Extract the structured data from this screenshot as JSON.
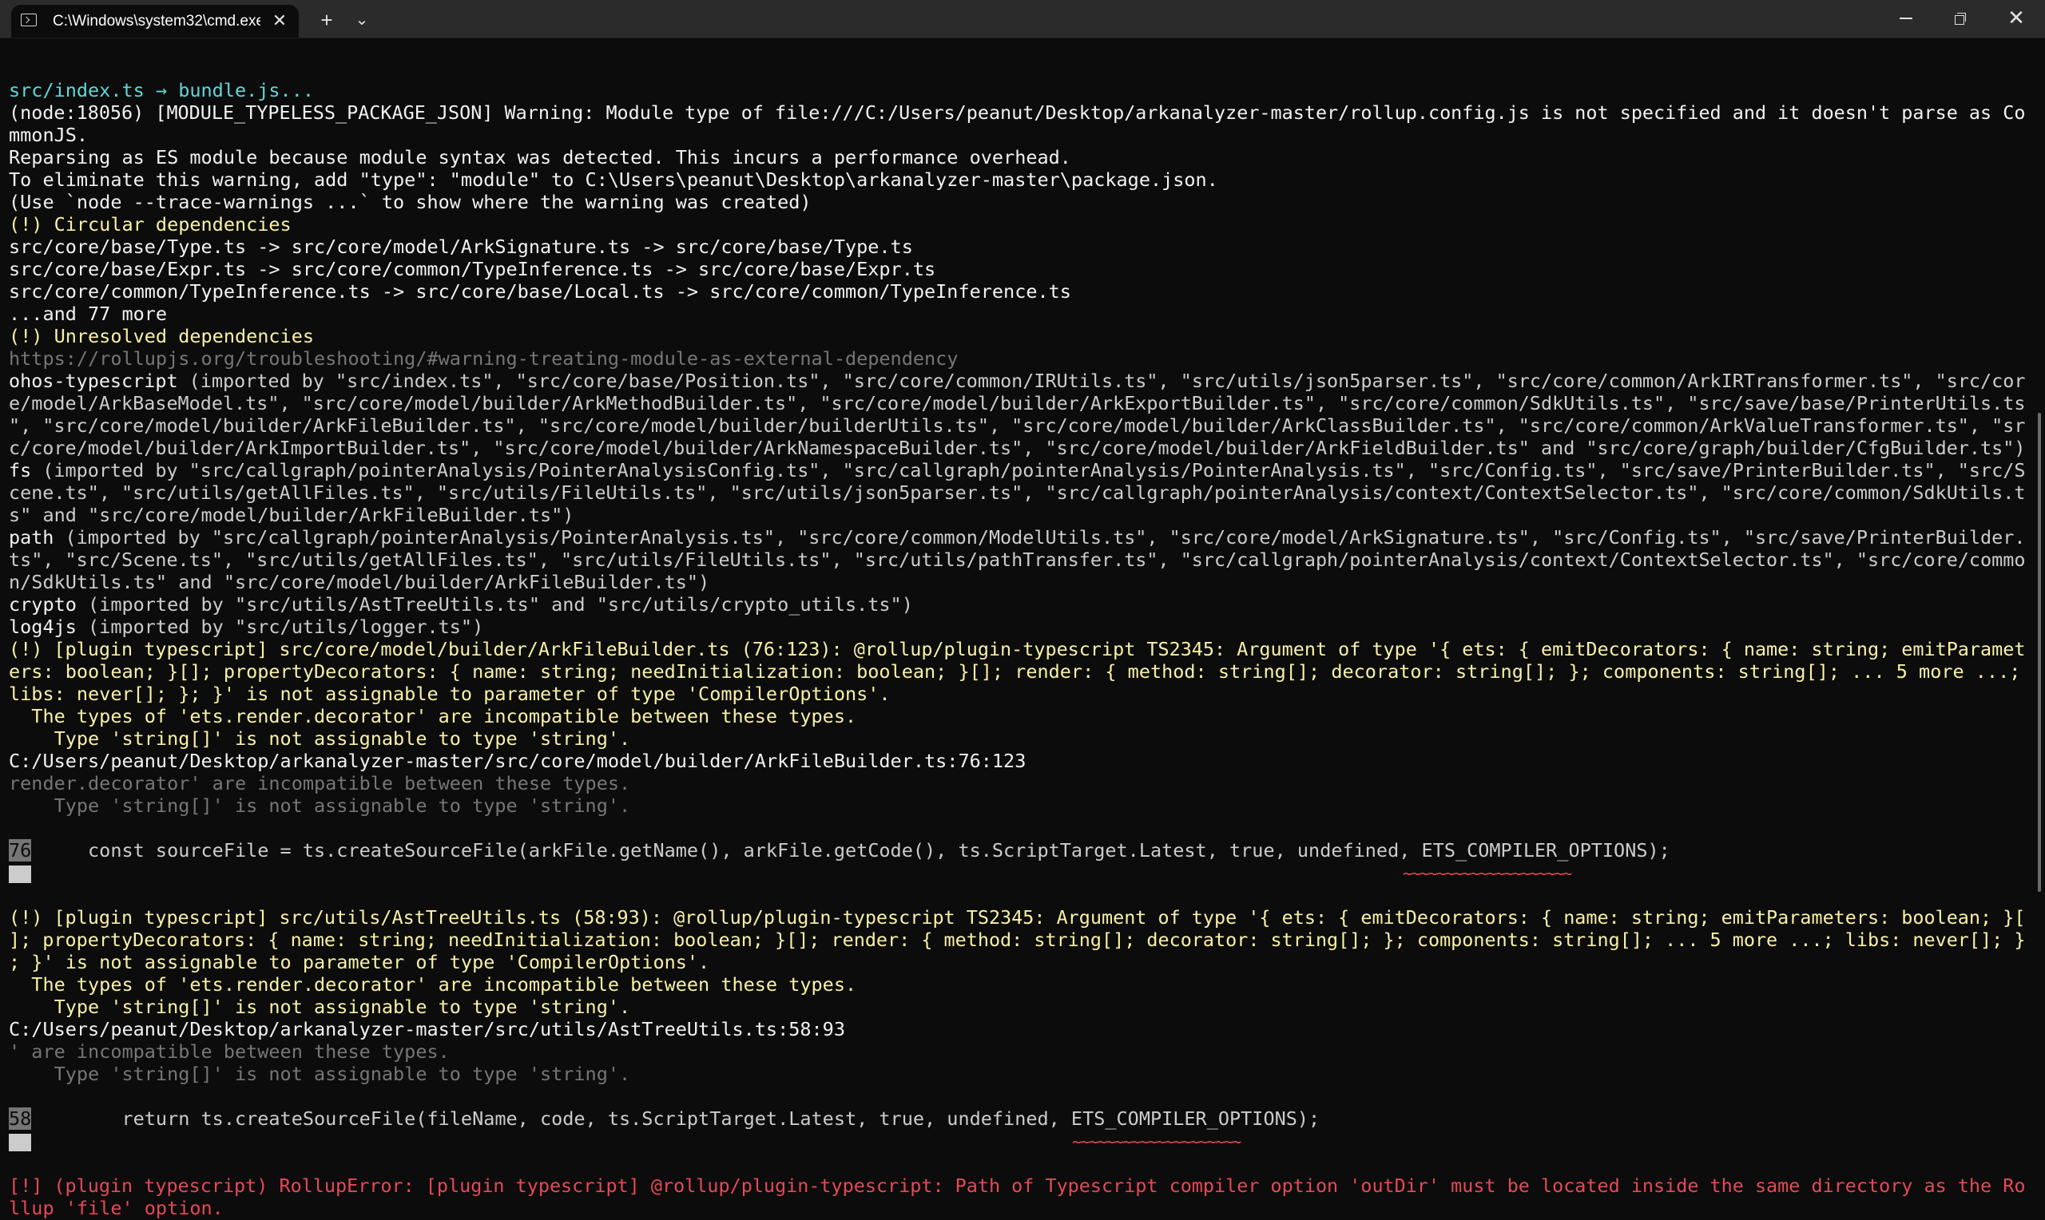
{
  "window": {
    "tab_title": "C:\\Windows\\system32\\cmd.exe",
    "tab_close_glyph": "✕",
    "new_tab_glyph": "+",
    "dropdown_glyph": "⌄",
    "close_glyph": "✕"
  },
  "terminal": {
    "lines": [
      "src/index.ts → bundle.js...",
      "(node:18056) [MODULE_TYPELESS_PACKAGE_JSON] Warning: Module type of file:///C:/Users/peanut/Desktop/arkanalyzer-master/rollup.config.js is not specified and it doesn't parse as Co",
      "mmonJS.",
      "Reparsing as ES module because module syntax was detected. This incurs a performance overhead.",
      "To eliminate this warning, add \"type\": \"module\" to C:\\Users\\peanut\\Desktop\\arkanalyzer-master\\package.json.",
      "(Use `node --trace-warnings ...` to show where the warning was created)",
      "(!) Circular dependencies",
      "src/core/base/Type.ts -> src/core/model/ArkSignature.ts -> src/core/base/Type.ts",
      "src/core/base/Expr.ts -> src/core/common/TypeInference.ts -> src/core/base/Expr.ts",
      "src/core/common/TypeInference.ts -> src/core/base/Local.ts -> src/core/common/TypeInference.ts",
      "...and 77 more",
      "(!) Unresolved dependencies",
      "https://rollupjs.org/troubleshooting/#warning-treating-module-as-external-dependency",
      "ohos-typescript",
      " (imported by \"src/index.ts\", \"src/core/base/Position.ts\", \"src/core/common/IRUtils.ts\", \"src/utils/json5parser.ts\", \"src/core/common/ArkIRTransformer.ts\", \"src/cor",
      "e/model/ArkBaseModel.ts\", \"src/core/model/builder/ArkMethodBuilder.ts\", \"src/core/model/builder/ArkExportBuilder.ts\", \"src/core/common/SdkUtils.ts\", \"src/save/base/PrinterUtils.ts",
      "\", \"src/core/model/builder/ArkFileBuilder.ts\", \"src/core/model/builder/builderUtils.ts\", \"src/core/model/builder/ArkClassBuilder.ts\", \"src/core/common/ArkValueTransformer.ts\", \"sr",
      "c/core/model/builder/ArkImportBuilder.ts\", \"src/core/model/builder/ArkNamespaceBuilder.ts\", \"src/core/model/builder/ArkFieldBuilder.ts\" and \"src/core/graph/builder/CfgBuilder.ts\")",
      "fs",
      " (imported by \"src/callgraph/pointerAnalysis/PointerAnalysisConfig.ts\", \"src/callgraph/pointerAnalysis/PointerAnalysis.ts\", \"src/Config.ts\", \"src/save/PrinterBuilder.ts\", \"src/S",
      "cene.ts\", \"src/utils/getAllFiles.ts\", \"src/utils/FileUtils.ts\", \"src/utils/json5parser.ts\", \"src/callgraph/pointerAnalysis/context/ContextSelector.ts\", \"src/core/common/SdkUtils.t",
      "s\" and \"src/core/model/builder/ArkFileBuilder.ts\")",
      "path",
      " (imported by \"src/callgraph/pointerAnalysis/PointerAnalysis.ts\", \"src/core/common/ModelUtils.ts\", \"src/core/model/ArkSignature.ts\", \"src/Config.ts\", \"src/save/PrinterBuilder.",
      "ts\", \"src/Scene.ts\", \"src/utils/getAllFiles.ts\", \"src/utils/FileUtils.ts\", \"src/utils/pathTransfer.ts\", \"src/callgraph/pointerAnalysis/context/ContextSelector.ts\", \"src/core/commo",
      "n/SdkUtils.ts\" and \"src/core/model/builder/ArkFileBuilder.ts\")",
      "crypto",
      " (imported by \"src/utils/AstTreeUtils.ts\" and \"src/utils/crypto_utils.ts\")",
      "log4js",
      " (imported by \"src/utils/logger.ts\")",
      "(!) [plugin typescript] src/core/model/builder/ArkFileBuilder.ts (76:123): @rollup/plugin-typescript TS2345: Argument of type '{ ets: { emitDecorators: { name: string; emitParamet",
      "ers: boolean; }[]; propertyDecorators: { name: string; needInitialization: boolean; }[]; render: { method: string[]; decorator: string[]; }; components: string[]; ... 5 more ...;",
      "libs: never[]; }; }' is not assignable to parameter of type 'CompilerOptions'.",
      "  The types of 'ets.render.decorator' are incompatible between these types.",
      "    Type 'string[]' is not assignable to type 'string'.",
      "C:/Users/peanut/Desktop/arkanalyzer-master/src/core/model/builder/ArkFileBuilder.ts:76:123",
      "render.decorator' are incompatible between these types.",
      "    Type 'string[]' is not assignable to type 'string'.",
      "76",
      "     const sourceFile = ts.createSourceFile(arkFile.getName(), arkFile.getCode(), ts.ScriptTarget.Latest, true, undefined, ETS_COMPILER_OPTIONS);",
      "~~~~~~~~~~~~~~~~~~~~",
      "(!) [plugin typescript] src/utils/AstTreeUtils.ts (58:93): @rollup/plugin-typescript TS2345: Argument of type '{ ets: { emitDecorators: { name: string; emitParameters: boolean; }[",
      "]; propertyDecorators: { name: string; needInitialization: boolean; }[]; render: { method: string[]; decorator: string[]; }; components: string[]; ... 5 more ...; libs: never[]; }",
      "; }' is not assignable to parameter of type 'CompilerOptions'.",
      "  The types of 'ets.render.decorator' are incompatible between these types.",
      "    Type 'string[]' is not assignable to type 'string'.",
      "C:/Users/peanut/Desktop/arkanalyzer-master/src/utils/AstTreeUtils.ts:58:93",
      "' are incompatible between these types.",
      "    Type 'string[]' is not assignable to type 'string'.",
      "58",
      "        return ts.createSourceFile(fileName, code, ts.ScriptTarget.Latest, true, undefined, ETS_COMPILER_OPTIONS);",
      "~~~~~~~~~~~~~~~~~~~~",
      "[!] (plugin typescript) RollupError: [plugin typescript] @rollup/plugin-typescript: Path of Typescript compiler option 'outDir' must be located inside the same directory as the Ro",
      "llup 'file' option."
    ]
  }
}
